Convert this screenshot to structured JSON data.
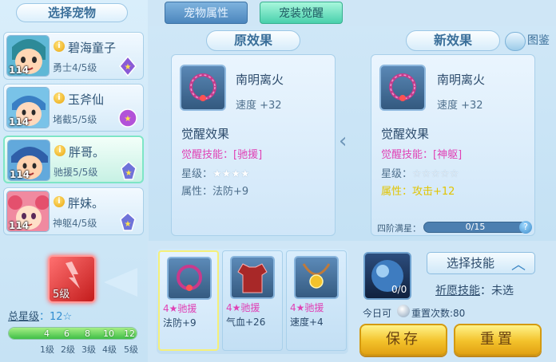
{
  "left": {
    "title": "选择宠物",
    "pets": [
      {
        "name": "碧海童子",
        "sub": "勇士4/5级",
        "level": "114"
      },
      {
        "name": "玉斧仙",
        "sub": "堵截5/5级",
        "level": "114"
      },
      {
        "name": "胖哥。",
        "sub": "驰援5/5级",
        "level": "114"
      },
      {
        "name": "胖妹。",
        "sub": "神躯4/5级",
        "level": "114"
      }
    ],
    "active_index": 2,
    "big_item_level": "5级",
    "total_star_label": "总星级",
    "total_star_value": "：12☆",
    "star_ticks": [
      "4",
      "6",
      "8",
      "10",
      "12"
    ],
    "star_levels": [
      "1级",
      "2级",
      "3级",
      "4级",
      "5级"
    ],
    "star_fill": 1.0
  },
  "tabs": {
    "attr": "宠物属性",
    "awaken": "宠装觉醒"
  },
  "original": {
    "title": "原效果",
    "item_name": "南明离火",
    "speed": "速度 +32",
    "awaken_head": "觉醒效果",
    "skill_label": "觉醒技能：",
    "skill_value": "[驰援]",
    "star_label": "星级：",
    "stars": "★★★★",
    "attr_label": "属性：",
    "attr_value": "法防+9"
  },
  "new": {
    "title": "新效果",
    "item_name": "南明离火",
    "speed": "速度 +32",
    "awaken_head": "觉醒效果",
    "skill_label": "觉醒技能：",
    "skill_value": "[神躯]",
    "star_label": "星级：",
    "stars": "☆☆☆☆☆",
    "attr_label": "属性：",
    "attr_value": "攻击+12",
    "progress_label": "四阶满星：",
    "progress_text": "0/15",
    "progress_value": 0
  },
  "guide_label": "图鉴",
  "slots": [
    {
      "name": "4★驰援",
      "attr": "法防+9"
    },
    {
      "name": "4★驰援",
      "attr": "气血+26"
    },
    {
      "name": "4★驰援",
      "attr": "速度+4"
    }
  ],
  "skill": {
    "orb_count": "0/0",
    "choose_label": "选择技能",
    "pray_label": "祈愿技能",
    "pray_value": "：未选",
    "today_label": "今日可",
    "reset_count": "重置次数:80"
  },
  "buttons": {
    "save": "保存",
    "reset": "重置"
  },
  "colors": {
    "pink": "#e041b5",
    "yellow": "#e2c400",
    "accent": "#49d0ac"
  }
}
